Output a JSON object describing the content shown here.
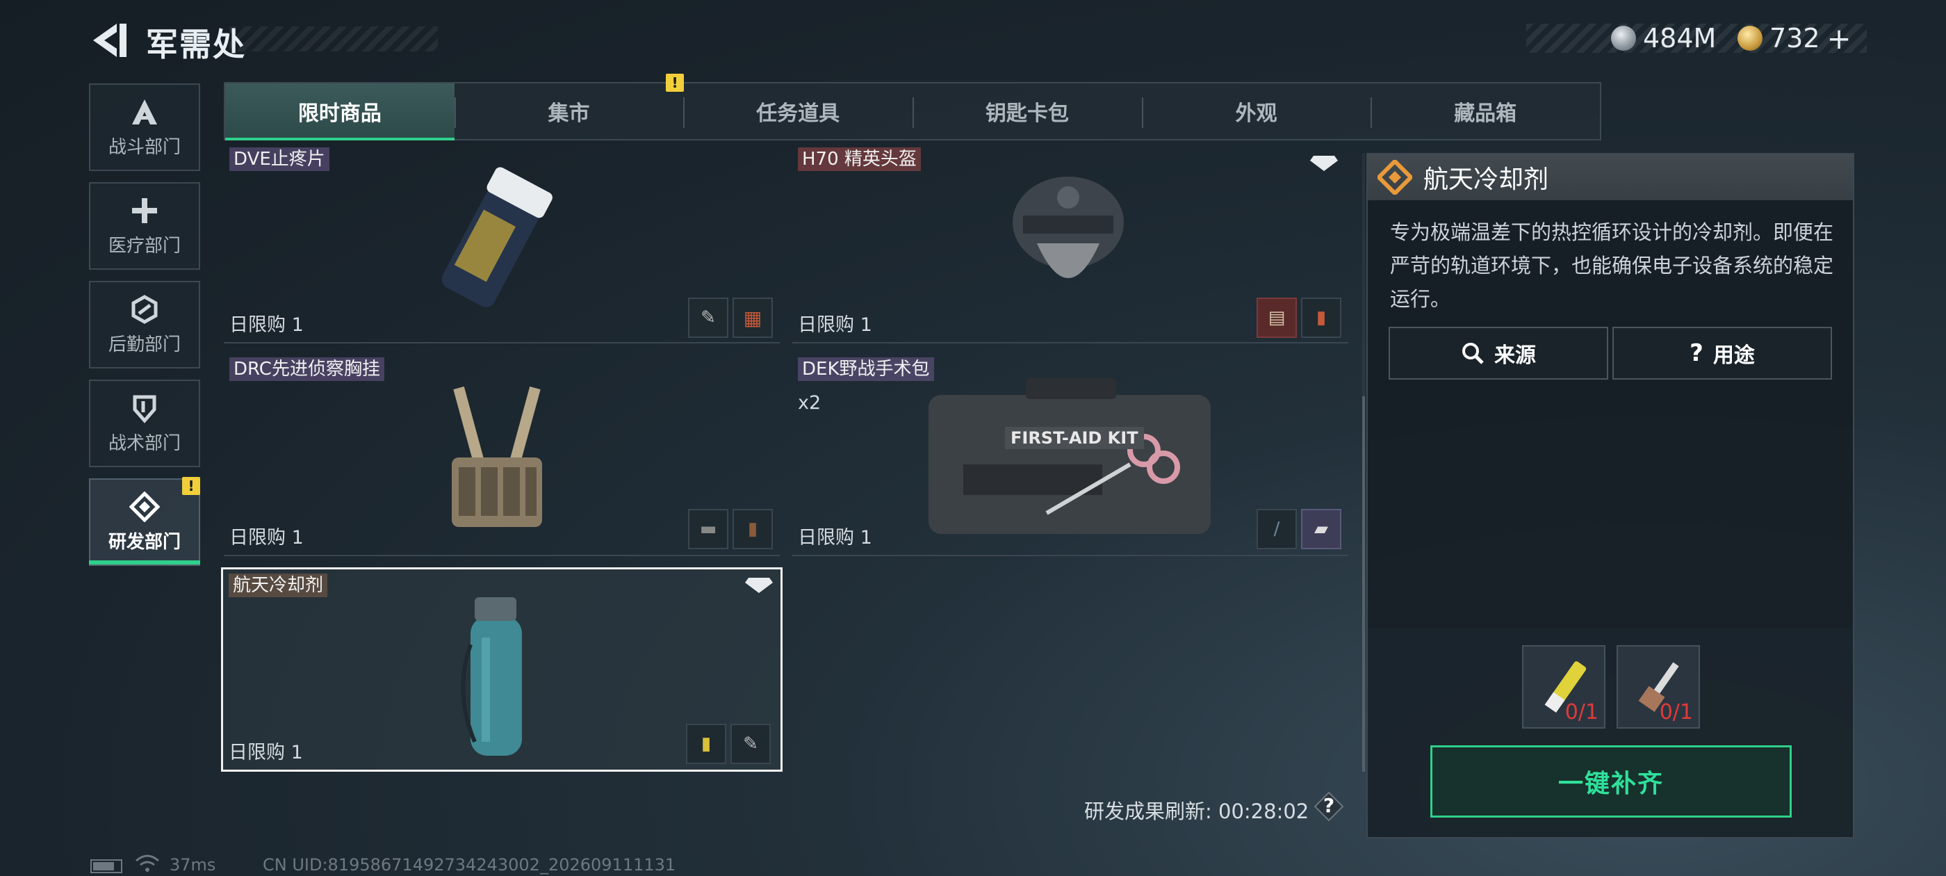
{
  "header": {
    "title": "军需处",
    "currencies": [
      {
        "icon": "silver-coin-icon",
        "value": "484M"
      },
      {
        "icon": "gold-coin-icon",
        "value": "732"
      }
    ],
    "plus_label": "+"
  },
  "sidebar": {
    "items": [
      {
        "label": "战斗部门",
        "icon": "combat-icon",
        "active": false
      },
      {
        "label": "医疗部门",
        "icon": "medical-cross-icon",
        "active": false
      },
      {
        "label": "后勤部门",
        "icon": "logistics-icon",
        "active": false
      },
      {
        "label": "战术部门",
        "icon": "shield-icon",
        "active": false
      },
      {
        "label": "研发部门",
        "icon": "research-icon",
        "active": true,
        "badge": "!"
      }
    ]
  },
  "tabs": [
    {
      "label": "限时商品",
      "active": true
    },
    {
      "label": "集市",
      "active": false,
      "badge": "!"
    },
    {
      "label": "任务道具",
      "active": false
    },
    {
      "label": "钥匙卡包",
      "active": false
    },
    {
      "label": "外观",
      "active": false
    },
    {
      "label": "藏品箱",
      "active": false
    }
  ],
  "items": [
    {
      "name": "DVE止疼片",
      "limit": "日限购 1",
      "tag": "purple"
    },
    {
      "name": "H70 精英头盔",
      "limit": "日限购 1",
      "tag": "red"
    },
    {
      "name": "DRC先进侦察胸挂",
      "limit": "日限购 1",
      "tag": "purple"
    },
    {
      "name": "DEK野战手术包",
      "limit": "日限购 1",
      "qty": "x2",
      "tag": "purple",
      "kit_text": "FIRST-AID KIT"
    },
    {
      "name": "航天冷却剂",
      "limit": "日限购 1",
      "tag": "brown",
      "selected": true
    }
  ],
  "timer": {
    "label": "研发成果刷新:",
    "value": "00:28:02",
    "help": "?"
  },
  "detail": {
    "title": "航天冷却剂",
    "description": "专为极端温差下的热控循环设计的冷却剂。即便在严苛的轨道环境下，也能确保电子设备系统的稳定运行。",
    "source_label": "来源",
    "usage_label": "用途",
    "usage_icon_text": "?",
    "requirements": [
      {
        "icon": "yellow-tube-icon",
        "count": "0/1"
      },
      {
        "icon": "brush-icon",
        "count": "0/1"
      }
    ],
    "fill_label": "一键补齐"
  },
  "status": {
    "ping": "37ms",
    "uid": "CN UID:81958671492734243002_202609111131"
  },
  "colors": {
    "accent": "#2fd08a",
    "badge": "#f1cf3a",
    "warning": "#e03a3a"
  }
}
